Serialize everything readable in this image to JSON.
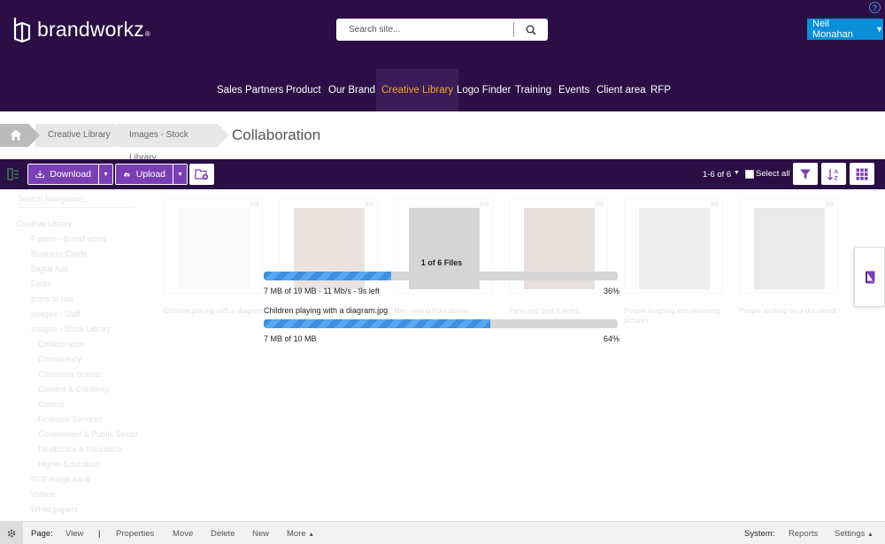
{
  "header": {
    "brand": "brandworkz",
    "brand_mark": "®",
    "search_placeholder": "Search site...",
    "user_name": "Neil Monahan",
    "help": "?"
  },
  "nav": {
    "items": [
      {
        "label": "Sales Partners"
      },
      {
        "label": "Product"
      },
      {
        "label": "Our Brand"
      },
      {
        "label": "Creative Library",
        "active": true
      },
      {
        "label": "Logo Finder"
      },
      {
        "label": "Training"
      },
      {
        "label": "Events"
      },
      {
        "label": "Client area"
      },
      {
        "label": "RFP"
      }
    ],
    "active_color": "#f5a623"
  },
  "breadcrumb": {
    "items": [
      "Creative Library",
      "Images - Stock Library"
    ],
    "current": "Collaboration"
  },
  "toolbar": {
    "download_label": "Download",
    "upload_label": "Upload",
    "count": "1-6 of 6",
    "select_all": "Select all"
  },
  "sidebar": {
    "search_placeholder": "Search Navigation...",
    "items": [
      "Creative Library",
      "Pattern - Brand world",
      "Business Cards",
      "Digital Ads",
      "Fonts",
      "Icons in use",
      "Images - Staff",
      "Images - Stock Library",
      "Collaboration",
      "Consistency",
      "Consumer brands",
      "Content & Creativity",
      "Control",
      "Financial Services",
      "Government & Public Sector",
      "Healthcare & Insurance",
      "Higher Education",
      "RFP image bank",
      "Videos",
      "White papers"
    ]
  },
  "grid": {
    "cards": [
      {
        "tag": "jpg",
        "label": "Children playing with a diagram"
      },
      {
        "tag": "jpg",
        "label": ""
      },
      {
        "tag": "jpg",
        "label": "Men rowing from above"
      },
      {
        "tag": "jpg",
        "label": "Pens and post-it notes"
      },
      {
        "tag": "jpg",
        "label": "People laughing and reviewing pictures"
      },
      {
        "tag": "jpg",
        "label": "People working on a document"
      }
    ]
  },
  "upload": {
    "files_count": "1 of 6 Files",
    "overall": {
      "text": "7 MB of 19 MB - 11 Mb/s - 9s left",
      "percent_label": "36%",
      "progress": 0.36
    },
    "file": {
      "name": "Children playing with a diagram.jpg",
      "text": "7 MB of 10 MB",
      "percent_label": "64%",
      "progress": 0.64
    }
  },
  "bottom_bar": {
    "page_label": "Page:",
    "view": "View",
    "separator": "|",
    "properties": "Properties",
    "move": "Move",
    "delete": "Delete",
    "new": "New",
    "more": "More",
    "system_label": "System:",
    "reports": "Reports",
    "settings": "Settings"
  },
  "colors": {
    "header_bg": "#2b0e45",
    "button_purple": "#7a3fb5",
    "user_blue": "#0a8fd8",
    "progress_blue": "#3d8fe0"
  },
  "icons": [
    "brandworkz-logo-icon",
    "search-icon",
    "help-icon",
    "home-icon",
    "tree-toggle-icon",
    "download-icon",
    "upload-cloud-icon",
    "folder-add-icon",
    "filter-icon",
    "sort-az-icon",
    "grid-view-icon",
    "book-icon",
    "gear-icon"
  ]
}
